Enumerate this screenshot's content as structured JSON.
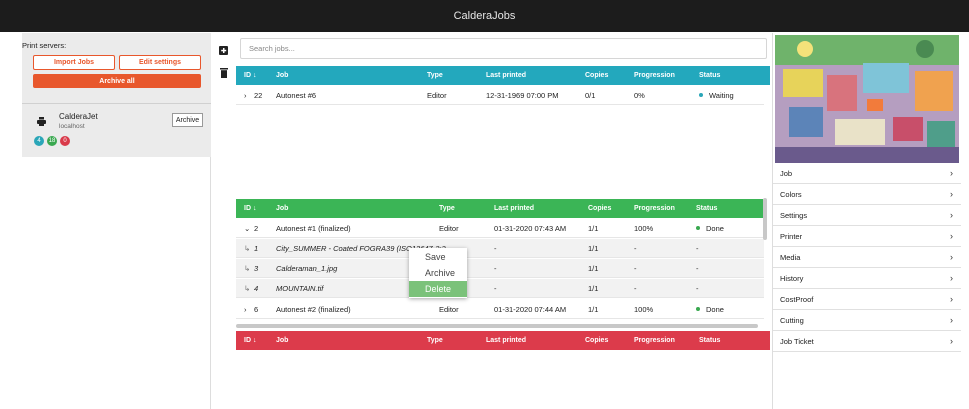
{
  "app": {
    "title": "CalderaJobs"
  },
  "left": {
    "print_servers_label": "Print servers:",
    "import_jobs": "Import Jobs",
    "edit_settings": "Edit settings",
    "archive_all": "Archive all",
    "printer": {
      "name": "CalderaJet",
      "host": "localhost",
      "archive": "Archive"
    },
    "badges": [
      {
        "count": "4",
        "color": "#2aa6b8"
      },
      {
        "count": "18",
        "color": "#39a84f"
      },
      {
        "count": "0",
        "color": "#d93a4a"
      }
    ]
  },
  "search": {
    "placeholder": "Search jobs..."
  },
  "columns": {
    "id": "ID ↓",
    "job": "Job",
    "type": "Type",
    "last_printed": "Last printed",
    "copies": "Copies",
    "progression": "Progression",
    "status": "Status"
  },
  "waiting_table": {
    "color": "#23a8bd",
    "rows": [
      {
        "expander": "›",
        "id": "22",
        "job": "Autonest #6",
        "type": "Editor",
        "last_printed": "12-31-1969 07:00 PM",
        "copies": "0/1",
        "progression": "0%",
        "status": "Waiting",
        "status_color": "#2aa6b8"
      }
    ]
  },
  "done_table": {
    "color": "#3bb556",
    "rows": [
      {
        "expander": "⌄",
        "id": "2",
        "job": "Autonest #1 (finalized)",
        "type": "Editor",
        "last_printed": "01-31-2020 07:43 AM",
        "copies": "1/1",
        "progression": "100%",
        "status": "Done",
        "status_color": "#39a84f",
        "child": false
      },
      {
        "expander": "↳",
        "id": "1",
        "job": "City_SUMMER - Coated FOGRA39 (ISO12647-2:2004).tif",
        "type": "",
        "last_printed": "-",
        "copies": "1/1",
        "progression": "-",
        "status": "-",
        "child": true
      },
      {
        "expander": "↳",
        "id": "3",
        "job": "Calderaman_1.jpg",
        "type": "",
        "last_printed": "-",
        "copies": "1/1",
        "progression": "-",
        "status": "-",
        "child": true
      },
      {
        "expander": "↳",
        "id": "4",
        "job": "MOUNTAIN.tif",
        "type": "",
        "last_printed": "-",
        "copies": "1/1",
        "progression": "-",
        "status": "-",
        "child": true
      },
      {
        "expander": "›",
        "id": "6",
        "job": "Autonest #2 (finalized)",
        "type": "Editor",
        "last_printed": "01-31-2020 07:44 AM",
        "copies": "1/1",
        "progression": "100%",
        "status": "Done",
        "status_color": "#39a84f",
        "child": false
      }
    ]
  },
  "error_table": {
    "color": "#dc3b4b"
  },
  "context_menu": {
    "items": [
      "Save",
      "Archive",
      "Delete"
    ],
    "active": "Delete"
  },
  "right_menu": {
    "items": [
      "Job",
      "Colors",
      "Settings",
      "Printer",
      "Media",
      "History",
      "CostProof",
      "Cutting",
      "Job Ticket"
    ]
  }
}
